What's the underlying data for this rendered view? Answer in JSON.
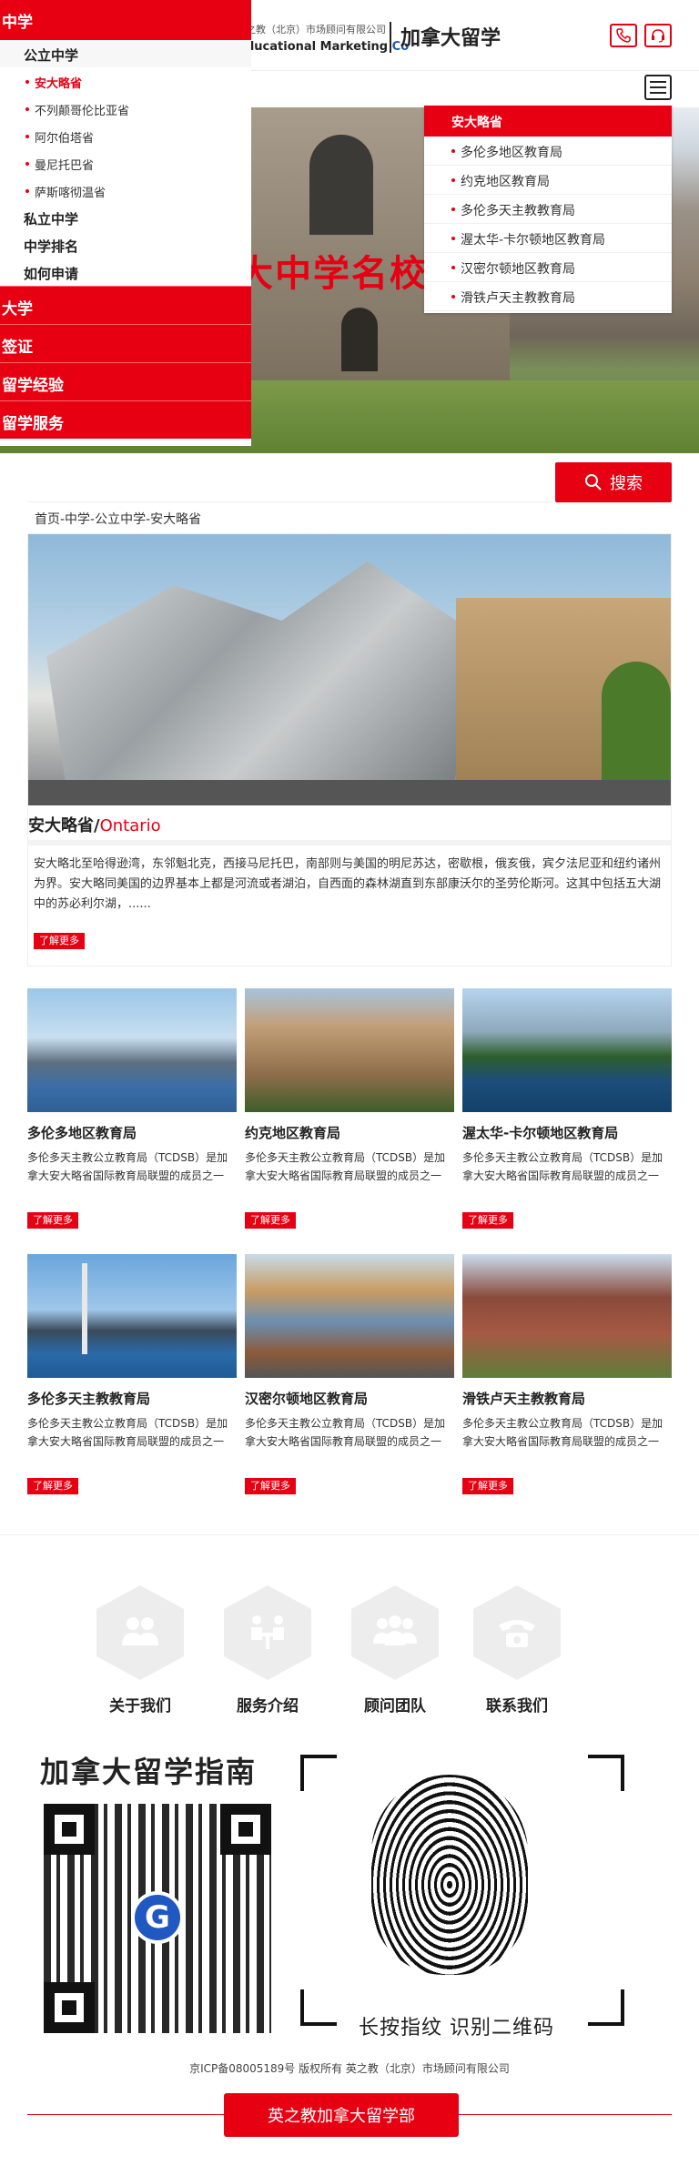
{
  "header": {
    "logo_sub": "之教（北京）市场顾问有限公司",
    "logo_en_left": "ducational Marketing",
    "logo_en_right": " Co",
    "title": "加拿大留学",
    "phone_icon": "phone-icon",
    "service_icon": "headset-icon",
    "menu_icon": "hamburger-menu-icon"
  },
  "sidenav": {
    "top": "中学",
    "l2_public": "公立中学",
    "provinces": [
      "安大略省",
      "不列颠哥伦比亚省",
      "阿尔伯塔省",
      "曼尼托巴省",
      "萨斯喀彻温省"
    ],
    "l2_private": "私立中学",
    "l2_ranking": "中学排名",
    "l2_apply": "如何申请",
    "red_items": [
      "大学",
      "签证",
      "留学经验",
      "留学服务"
    ]
  },
  "hero": {
    "text": "大中学名校"
  },
  "submenu": {
    "head": "安大略省",
    "items": [
      "多伦多地区教育局",
      "约克地区教育局",
      "多伦多天主教教育局",
      "渥太华-卡尔顿地区教育局",
      "汉密尔顿地区教育局",
      "滑铁卢天主教教育局"
    ]
  },
  "search": {
    "button_label": "搜索",
    "icon": "search-icon"
  },
  "breadcrumb": "首页-中学-公立中学-安大略省",
  "feature": {
    "title_cn": "安大略省/",
    "title_en": "Ontario",
    "desc": "安大略北至哈得逊湾，东邻魁北克，西接马尼托巴，南部则与美国的明尼苏达，密歇根，俄亥俄，宾夕法尼亚和纽约诸州为界。安大略同美国的边界基本上都是河流或者湖泊，自西面的森林湖直到东部康沃尔的圣劳伦斯河。这其中包括五大湖中的苏必利尔湖，......",
    "more": "了解更多"
  },
  "cards": [
    {
      "title": "多伦多地区教育局",
      "desc": "多伦多天主教公立教育局（TCDSB）是加拿大安大略省国际教育局联盟的成员之一",
      "more": "了解更多"
    },
    {
      "title": "约克地区教育局",
      "desc": "多伦多天主教公立教育局（TCDSB）是加拿大安大略省国际教育局联盟的成员之一",
      "more": "了解更多"
    },
    {
      "title": "渥太华-卡尔顿地区教育局",
      "desc": "多伦多天主教公立教育局（TCDSB）是加拿大安大略省国际教育局联盟的成员之一",
      "more": "了解更多"
    },
    {
      "title": "多伦多天主教教育局",
      "desc": "多伦多天主教公立教育局（TCDSB）是加拿大安大略省国际教育局联盟的成员之一",
      "more": "了解更多"
    },
    {
      "title": "汉密尔顿地区教育局",
      "desc": "多伦多天主教公立教育局（TCDSB）是加拿大安大略省国际教育局联盟的成员之一",
      "more": "了解更多"
    },
    {
      "title": "滑铁卢天主教教育局",
      "desc": "多伦多天主教公立教育局（TCDSB）是加拿大安大略省国际教育局联盟的成员之一",
      "more": "了解更多"
    }
  ],
  "bottom_nav": [
    {
      "label": "关于我们",
      "icon": "people-icon"
    },
    {
      "label": "服务介绍",
      "icon": "meeting-icon"
    },
    {
      "label": "顾问团队",
      "icon": "team-icon"
    },
    {
      "label": "联系我们",
      "icon": "telephone-icon"
    }
  ],
  "guide": {
    "title": "加拿大留学指南",
    "qr_logo": "G",
    "scan_hint": "长按指纹 识别二维码"
  },
  "footer": {
    "icp": "京ICP备08005189号 版权所有 英之教（北京）市场顾问有限公司",
    "button": "英之教加拿大留学部"
  },
  "colors": {
    "brand_red": "#e60012"
  }
}
